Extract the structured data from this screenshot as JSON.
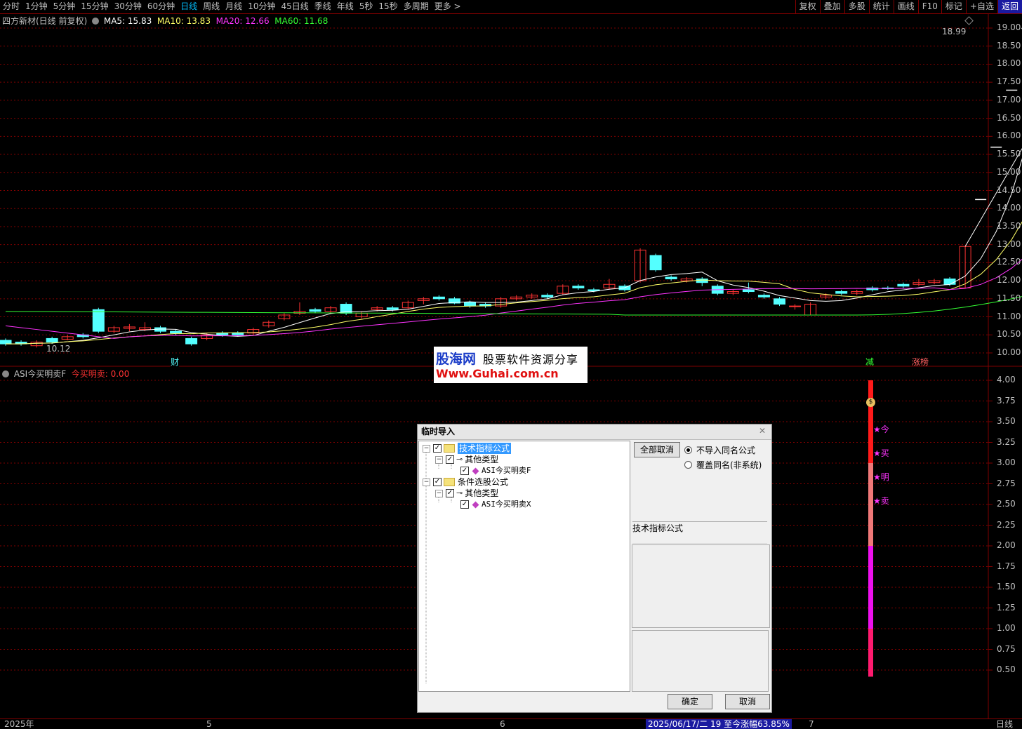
{
  "toolbar": {
    "periods": [
      "分时",
      "1分钟",
      "5分钟",
      "15分钟",
      "30分钟",
      "60分钟",
      "日线",
      "周线",
      "月线",
      "10分钟",
      "45日线",
      "季线",
      "年线",
      "5秒",
      "15秒",
      "多周期",
      "更多 >"
    ],
    "active_period": "日线",
    "tools": [
      "复权",
      "叠加",
      "多股",
      "统计",
      "画线",
      "F10",
      "标记",
      "+自选",
      "返回"
    ]
  },
  "main_legend": {
    "title": "四方新材(日线 前复权)",
    "ma5": "MA5: 15.83",
    "ma10": "MA10: 13.83",
    "ma20": "MA20: 12.66",
    "ma60": "MA60: 11.68"
  },
  "colors": {
    "up": "#ff3232",
    "down": "#54ffff",
    "ma5": "#ffffff",
    "ma10": "#ffff66",
    "ma20": "#ff33ff",
    "ma60": "#33ff33",
    "grid": "#800000"
  },
  "main_chart": {
    "y_ticks": [
      "19.00",
      "18.50",
      "18.00",
      "17.50",
      "17.00",
      "16.50",
      "16.00",
      "15.50",
      "15.00",
      "14.50",
      "14.00",
      "13.50",
      "13.00",
      "12.50",
      "12.00",
      "11.50",
      "11.00",
      "10.50",
      "10.00"
    ],
    "high_label": "18.99",
    "low_label": "10.12",
    "markers": [
      {
        "text": "财",
        "color": "#54ffff"
      },
      {
        "text": "减",
        "color": "#33ff33"
      },
      {
        "text": "涨榜",
        "color": "#ff6060"
      }
    ]
  },
  "indicator": {
    "name": "ASI今买明卖F",
    "value_label": "今买明卖: 0.00",
    "y_ticks": [
      "4.00",
      "3.75",
      "3.50",
      "3.25",
      "3.00",
      "2.75",
      "2.50",
      "2.25",
      "2.00",
      "1.75",
      "1.50",
      "1.25",
      "1.00",
      "0.75",
      "0.50"
    ],
    "signal_chars": [
      "★今",
      "★买",
      "★明",
      "★卖"
    ]
  },
  "watermark": {
    "logo": "股海网",
    "slogan": "股票软件资源分享",
    "url": "Www.Guhai.com.cn"
  },
  "bottom": {
    "x_labels": [
      "2025年",
      "5",
      "6",
      "7"
    ],
    "status": "2025/06/17/二 19 至今涨幅63.85%",
    "mode": "日线"
  },
  "dialog": {
    "title": "临时导入",
    "tree": [
      {
        "label": "技术指标公式",
        "level": 0,
        "selected": true
      },
      {
        "label": "其他类型",
        "level": 1
      },
      {
        "label": "ASI今买明卖F",
        "level": 2
      },
      {
        "label": "条件选股公式",
        "level": 0
      },
      {
        "label": "其他类型",
        "level": 1
      },
      {
        "label": "ASI今买明卖X",
        "level": 2
      }
    ],
    "clear_all": "全部取消",
    "radio_skip": "不导入同名公式",
    "radio_overwrite": "覆盖同名(非系统)",
    "group_label": "技术指标公式",
    "ok": "确定",
    "cancel": "取消"
  }
}
